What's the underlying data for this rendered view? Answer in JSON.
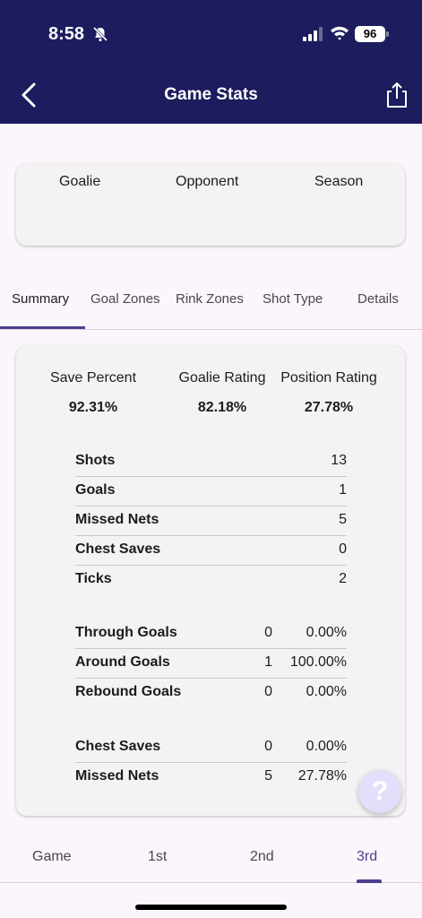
{
  "status_bar": {
    "time": "8:58",
    "battery": "96"
  },
  "header": {
    "title": "Game Stats"
  },
  "filters": {
    "goalie": "Goalie",
    "opponent": "Opponent",
    "season": "Season"
  },
  "tabs": [
    "Summary",
    "Goal Zones",
    "Rink Zones",
    "Shot Type",
    "Details"
  ],
  "active_tab": "Summary",
  "metrics": [
    {
      "label": "Save Percent",
      "value": "92.31%"
    },
    {
      "label": "Goalie Rating",
      "value": "82.18%"
    },
    {
      "label": "Position Rating",
      "value": "27.78%"
    }
  ],
  "stats": [
    {
      "label": "Shots",
      "value": "13"
    },
    {
      "label": "Goals",
      "value": "1"
    },
    {
      "label": "Missed Nets",
      "value": "5"
    },
    {
      "label": "Chest Saves",
      "value": "0"
    },
    {
      "label": "Ticks",
      "value": "2"
    }
  ],
  "goal_types": [
    {
      "label": "Through Goals",
      "count": "0",
      "pct": "0.00%"
    },
    {
      "label": "Around Goals",
      "count": "1",
      "pct": "100.00%"
    },
    {
      "label": "Rebound Goals",
      "count": "0",
      "pct": "0.00%"
    }
  ],
  "save_types": [
    {
      "label": "Chest Saves",
      "count": "0",
      "pct": "0.00%"
    },
    {
      "label": "Missed Nets",
      "count": "5",
      "pct": "27.78%"
    }
  ],
  "help": "?",
  "periods": [
    "Game",
    "1st",
    "2nd",
    "3rd"
  ],
  "active_period": "3rd",
  "colors": {
    "header_bg": "#1c1c5e",
    "accent": "#4b3f8f",
    "card_bg": "#f3f3f3"
  }
}
